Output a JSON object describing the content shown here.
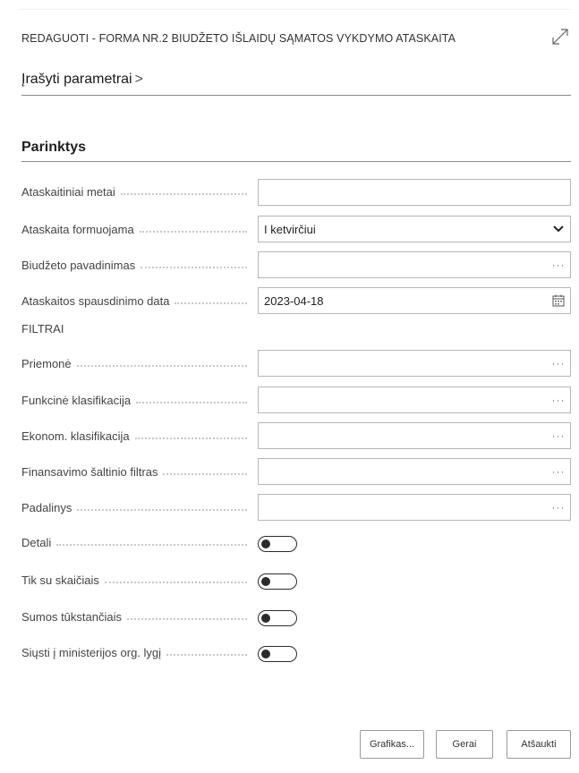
{
  "dialog": {
    "title": "REDAGUOTI - FORMA NR.2 BIUDŽETO IŠLAIDŲ SĄMATOS VYKDYMO ATASKAITA",
    "record_params_label": "Įrašyti parametrai",
    "record_params_chevron": ">",
    "section_title": "Parinktys"
  },
  "fields": {
    "report_year": {
      "label": "Ataskaitiniai metai",
      "value": ""
    },
    "report_formed": {
      "label": "Ataskaita formuojama",
      "value": "I ketvirčiui"
    },
    "budget_name": {
      "label": "Biudžeto pavadinimas",
      "value": "",
      "suffix": "···"
    },
    "print_date": {
      "label": "Ataskaitos spausdinimo data",
      "value": "2023-04-18"
    }
  },
  "filters": {
    "heading": "FILTRAI",
    "measure": {
      "label": "Priemonė",
      "value": "",
      "suffix": "···"
    },
    "functional": {
      "label": "Funkcinė klasifikacija",
      "value": "",
      "suffix": "···"
    },
    "economic": {
      "label": "Ekonom. klasifikacija",
      "value": "",
      "suffix": "···"
    },
    "funding_source": {
      "label": "Finansavimo šaltinio filtras",
      "value": "",
      "suffix": "···"
    },
    "department": {
      "label": "Padalinys",
      "value": "",
      "suffix": "···"
    }
  },
  "toggles": {
    "details": {
      "label": "Detali",
      "on": false
    },
    "only_numbers": {
      "label": "Tik su skaičiais",
      "on": false
    },
    "thousands": {
      "label": "Sumos tūkstančiais",
      "on": false
    },
    "ministry": {
      "label": "Siųsti į ministerijos org. lygį",
      "on": false
    }
  },
  "buttons": {
    "schedule": "Grafikas...",
    "ok": "Gerai",
    "cancel": "Atšaukti"
  }
}
